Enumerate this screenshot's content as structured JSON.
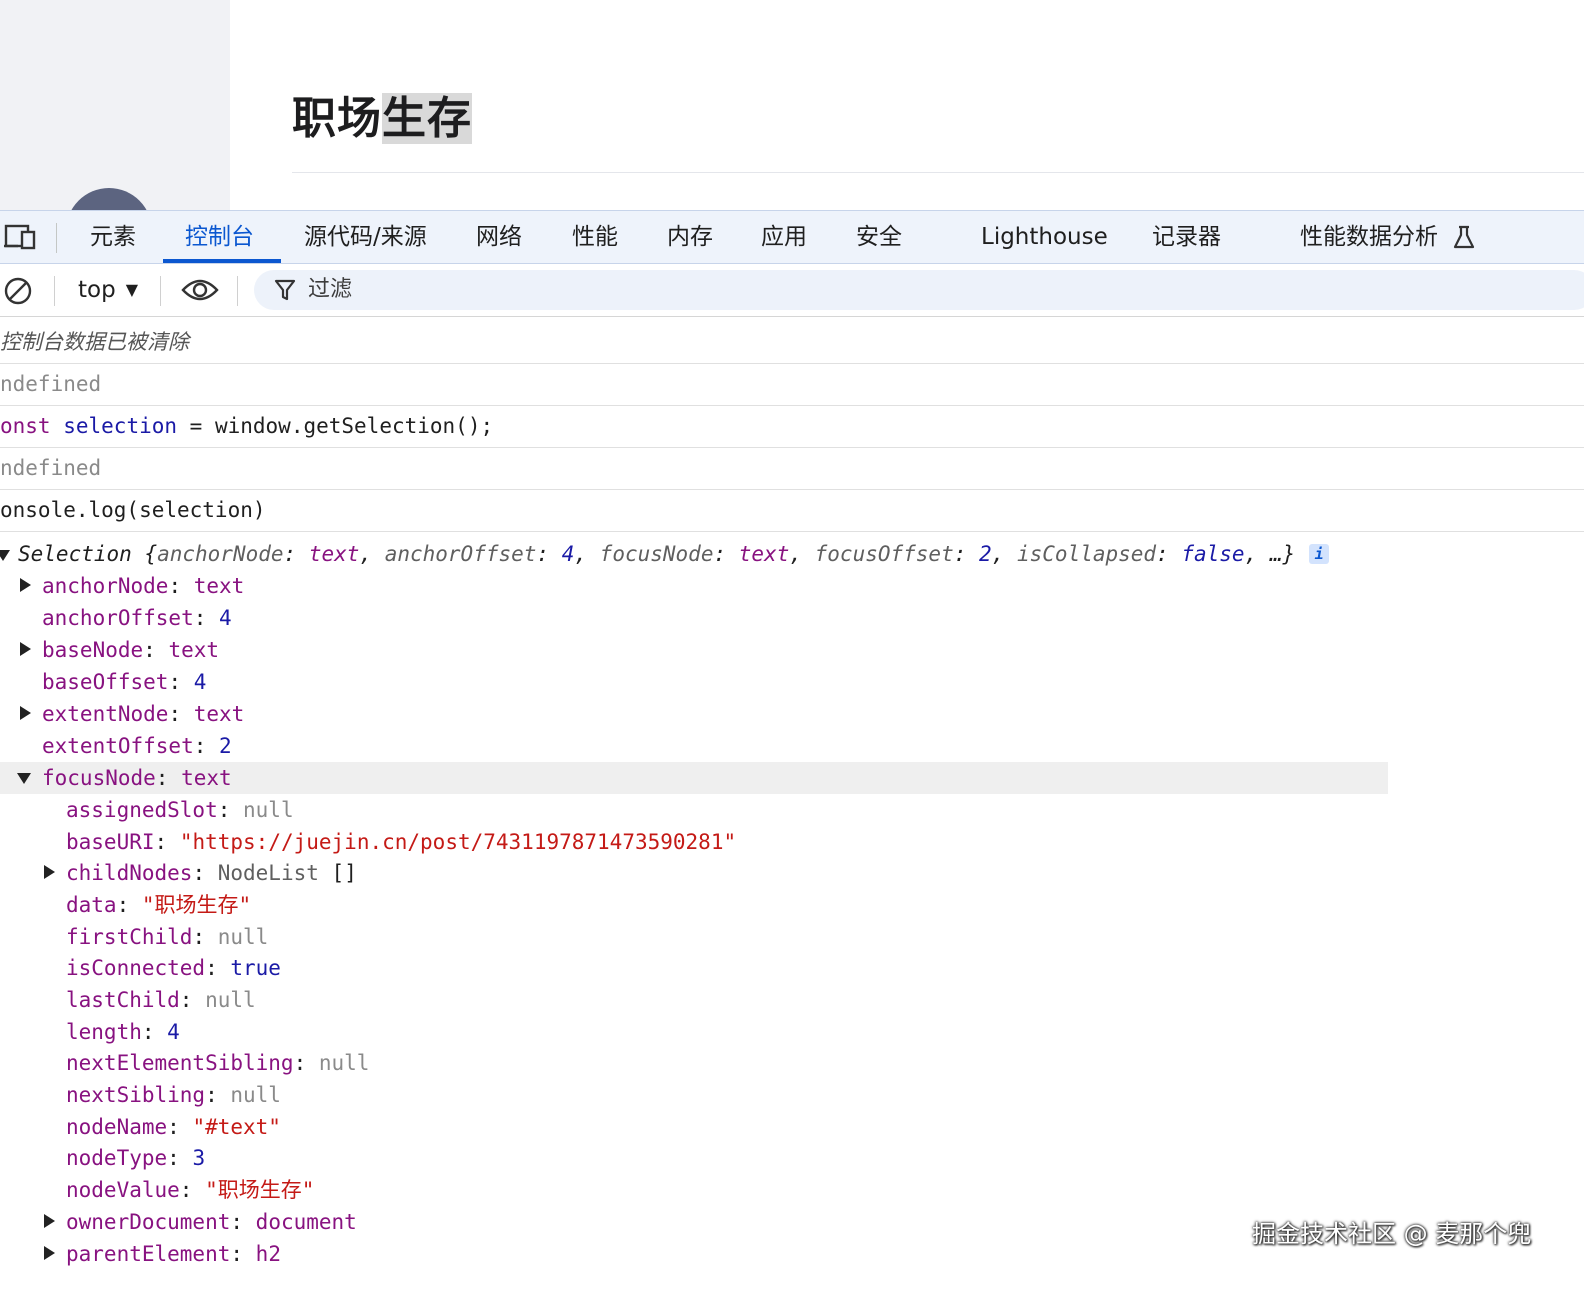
{
  "page": {
    "article_title_unselected": "职场",
    "article_title_selected": "生存"
  },
  "devtools": {
    "tabs": [
      {
        "label": "元素"
      },
      {
        "label": "控制台"
      },
      {
        "label": "源代码/来源"
      },
      {
        "label": "网络"
      },
      {
        "label": "性能"
      },
      {
        "label": "内存"
      },
      {
        "label": "应用"
      },
      {
        "label": "安全"
      },
      {
        "label": "Lighthouse"
      },
      {
        "label": "记录器"
      },
      {
        "label": "性能数据分析"
      }
    ],
    "active_tab": "控制台",
    "toolbar": {
      "context": "top",
      "filter_placeholder": "过滤"
    },
    "icons": [
      "device-toggle-icon",
      "flask-icon",
      "clear-console-icon",
      "dropdown-arrow-icon",
      "eye-icon",
      "filter-icon",
      "expand-triangle-icon",
      "collapse-triangle-icon",
      "info-icon"
    ],
    "colors": {
      "accent": "#0b57d0",
      "key": "#881280",
      "string": "#c41a16",
      "number": "#1a1aa6",
      "null": "#8a8a8a"
    }
  },
  "console": {
    "cleared_msg": "控制台数据已被清除",
    "result_1": "ndefined",
    "input_1": {
      "kw": "onst",
      "var": "selection",
      "rest": " = window.getSelection();"
    },
    "result_2": "ndefined",
    "input_2": "onsole.log(selection)",
    "summary": {
      "type": "Selection",
      "open": " {",
      "k1": "anchorNode",
      "v1": "text",
      "k2": "anchorOffset",
      "v2": "4",
      "k3": "focusNode",
      "v3": "text",
      "k4": "focusOffset",
      "v4": "2",
      "k5": "isCollapsed",
      "v5": "false",
      "close": "…}",
      "info": "i"
    },
    "props": [
      {
        "key": "anchorNode",
        "value": "text"
      },
      {
        "key": "anchorOffset",
        "value": "4"
      },
      {
        "key": "baseNode",
        "value": "text"
      },
      {
        "key": "baseOffset",
        "value": "4"
      },
      {
        "key": "extentNode",
        "value": "text"
      },
      {
        "key": "extentOffset",
        "value": "2"
      },
      {
        "key": "focusNode",
        "value": "text"
      }
    ],
    "focus_props": [
      {
        "key": "assignedSlot",
        "value": "null"
      },
      {
        "key": "baseURI",
        "value": "\"https://juejin.cn/post/7431197871473590281\""
      },
      {
        "key": "childNodes",
        "value": "NodeList",
        "extra": "[]"
      },
      {
        "key": "data",
        "value": "\"职场生存\""
      },
      {
        "key": "firstChild",
        "value": "null"
      },
      {
        "key": "isConnected",
        "value": "true"
      },
      {
        "key": "lastChild",
        "value": "null"
      },
      {
        "key": "length",
        "value": "4"
      },
      {
        "key": "nextElementSibling",
        "value": "null"
      },
      {
        "key": "nextSibling",
        "value": "null"
      },
      {
        "key": "nodeName",
        "value": "\"#text\""
      },
      {
        "key": "nodeType",
        "value": "3"
      },
      {
        "key": "nodeValue",
        "value": "\"职场生存\""
      },
      {
        "key": "ownerDocument",
        "value": "document"
      },
      {
        "key": "parentElement",
        "value": "h2"
      }
    ]
  },
  "watermark": "掘金技术社区 @ 麦那个兜"
}
